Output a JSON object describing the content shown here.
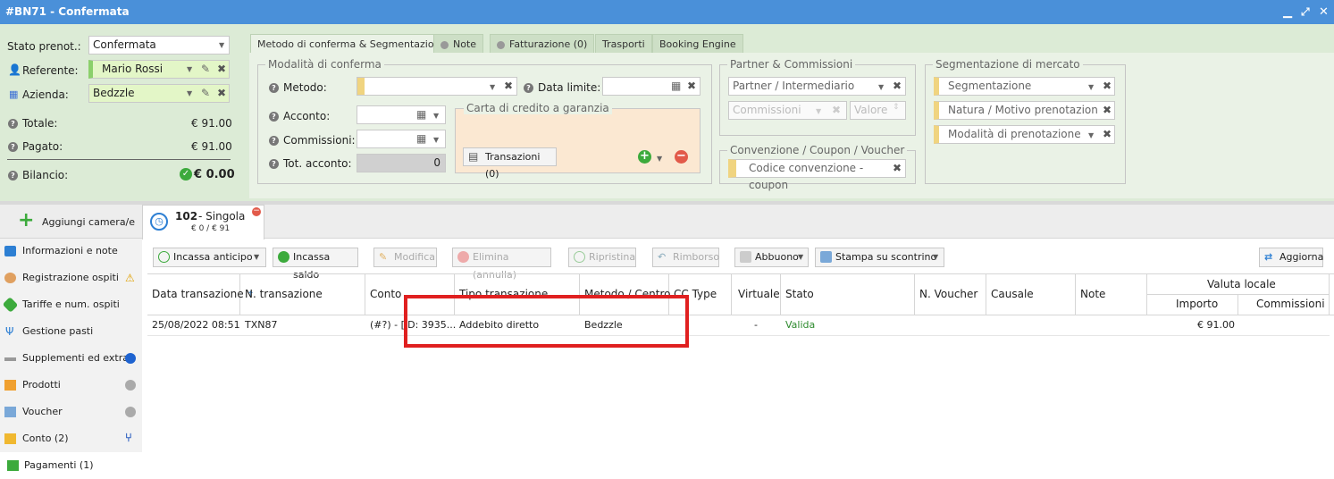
{
  "window": {
    "title": "#BN71 - Confermata"
  },
  "summary": {
    "stato_label": "Stato prenot.:",
    "stato_value": "Confermata",
    "referente_label": "Referente:",
    "referente_value": "Mario Rossi",
    "azienda_label": "Azienda:",
    "azienda_value": "Bedzzle",
    "totale_label": "Totale:",
    "totale_value": "€ 91.00",
    "pagato_label": "Pagato:",
    "pagato_value": "€ 91.00",
    "bilancio_label": "Bilancio:",
    "bilancio_value": "€ 0.00"
  },
  "tabs": [
    "Metodo di conferma & Segmentazione",
    "Note",
    "Fatturazione (0)",
    "Trasporti",
    "Booking Engine"
  ],
  "conferma": {
    "legend": "Modalità di conferma",
    "metodo_label": "Metodo:",
    "data_limite_label": "Data limite:",
    "acconto_label": "Acconto:",
    "commissioni_label": "Commissioni:",
    "tot_acconto_label": "Tot. acconto:",
    "tot_acconto_value": "0",
    "carta_legend": "Carta di credito a garanzia",
    "transazioni_button": "Transazioni (0)"
  },
  "partner": {
    "legend": "Partner & Commissioni",
    "partner_placeholder": "Partner / Intermediario",
    "commissioni_placeholder": "Commissioni",
    "valore_placeholder": "Valore"
  },
  "convenzione": {
    "legend": "Convenzione / Coupon / Voucher",
    "placeholder": "Codice convenzione - coupon"
  },
  "segmentazione": {
    "legend": "Segmentazione di mercato",
    "items": [
      "Segmentazione",
      "Natura / Motivo prenotazion",
      "Modalità di prenotazione"
    ]
  },
  "room": {
    "add_label": "Aggiungi camera/e",
    "number": "102",
    "type": "- Singola",
    "price": "€ 0 / € 91"
  },
  "nav": [
    "Informazioni e note",
    "Registrazione ospiti",
    "Tariffe e num. ospiti",
    "Gestione pasti",
    "Supplementi ed extra",
    "Prodotti",
    "Voucher",
    "Conto (2)",
    "Pagamenti (1)"
  ],
  "toolbar": {
    "incassa_anticipo": "Incassa anticipo",
    "incassa_saldo": "Incassa saldo",
    "modifica": "Modifica",
    "elimina": "Elimina (annulla)",
    "ripristina": "Ripristina",
    "rimborso": "Rimborso",
    "abbuono": "Abbuono",
    "stampa": "Stampa su scontrino",
    "aggiorna": "Aggiorna"
  },
  "table": {
    "headers": [
      "Data transazione",
      "N. transazione",
      "Conto",
      "Tipo transazione",
      "Metodo / Centro",
      "CC Type",
      "Virtuale",
      "Stato",
      "N. Voucher",
      "Causale",
      "Note"
    ],
    "group_header": "Valuta locale",
    "sub_headers": [
      "Importo",
      "Commissioni"
    ],
    "rows": [
      {
        "data": "25/08/2022 08:51",
        "n": "TXN87",
        "conto": "(#?) - [ID: 3935...",
        "tipo": "Addebito diretto",
        "metodo": "Bedzzle",
        "virtuale": "-",
        "stato": "Valida",
        "importo": "€ 91.00"
      }
    ]
  },
  "colors": {
    "titlebar": "#4a90d9",
    "panel": "#dcebd6",
    "valid": "#2e8b2e",
    "highlight": "#e02020"
  }
}
